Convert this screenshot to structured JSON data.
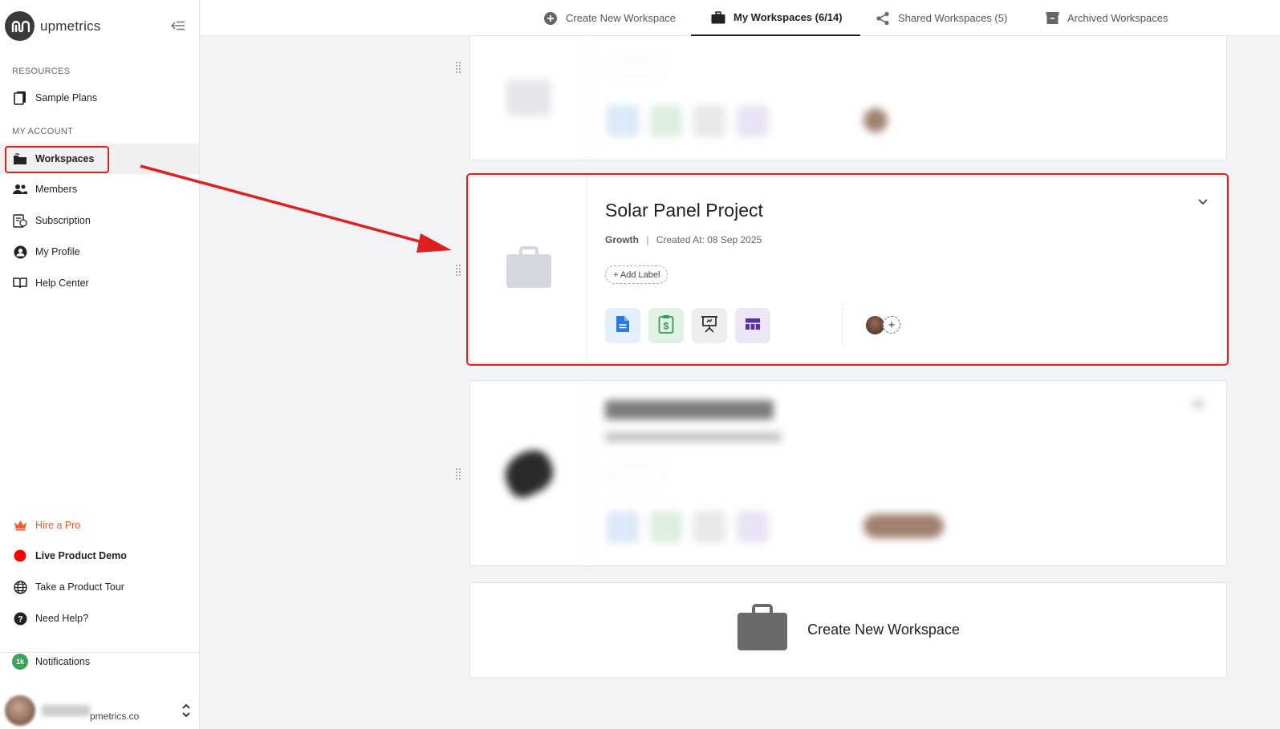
{
  "app": {
    "name": "upmetrics"
  },
  "sidebar": {
    "resources_label": "RESOURCES",
    "resources": [
      {
        "label": "Sample Plans"
      }
    ],
    "account_label": "MY ACCOUNT",
    "account": [
      {
        "label": "Workspaces",
        "active": true
      },
      {
        "label": "Members"
      },
      {
        "label": "Subscription"
      },
      {
        "label": "My Profile"
      },
      {
        "label": "Help Center"
      }
    ],
    "bottom": [
      {
        "label": "Hire a Pro"
      },
      {
        "label": "Live Product Demo"
      },
      {
        "label": "Take a Product Tour"
      },
      {
        "label": "Need Help?"
      }
    ],
    "notifications": {
      "label": "Notifications",
      "badge": "1k"
    },
    "user": {
      "email_suffix": "pmetrics.co"
    }
  },
  "tabs": [
    {
      "label": "Create New Workspace",
      "icon": "plus-circle-icon"
    },
    {
      "label": "My Workspaces (6/14)",
      "icon": "briefcase-icon",
      "active": true
    },
    {
      "label": "Shared Workspaces (5)",
      "icon": "share-icon"
    },
    {
      "label": "Archived Workspaces",
      "icon": "archive-icon"
    }
  ],
  "workspace": {
    "title": "Solar Panel Project",
    "plan": "Growth",
    "separator": "|",
    "created": "Created At: 08 Sep 2025",
    "add_label": "+ Add Label",
    "tools": [
      "document-icon",
      "financial-icon",
      "presentation-icon",
      "dashboard-icon"
    ]
  },
  "create_card": {
    "label": "Create New Workspace"
  },
  "colors": {
    "highlight": "#e02020",
    "hire": "#f25c2c",
    "live": "#ff0000",
    "notif": "#3aa55a"
  }
}
